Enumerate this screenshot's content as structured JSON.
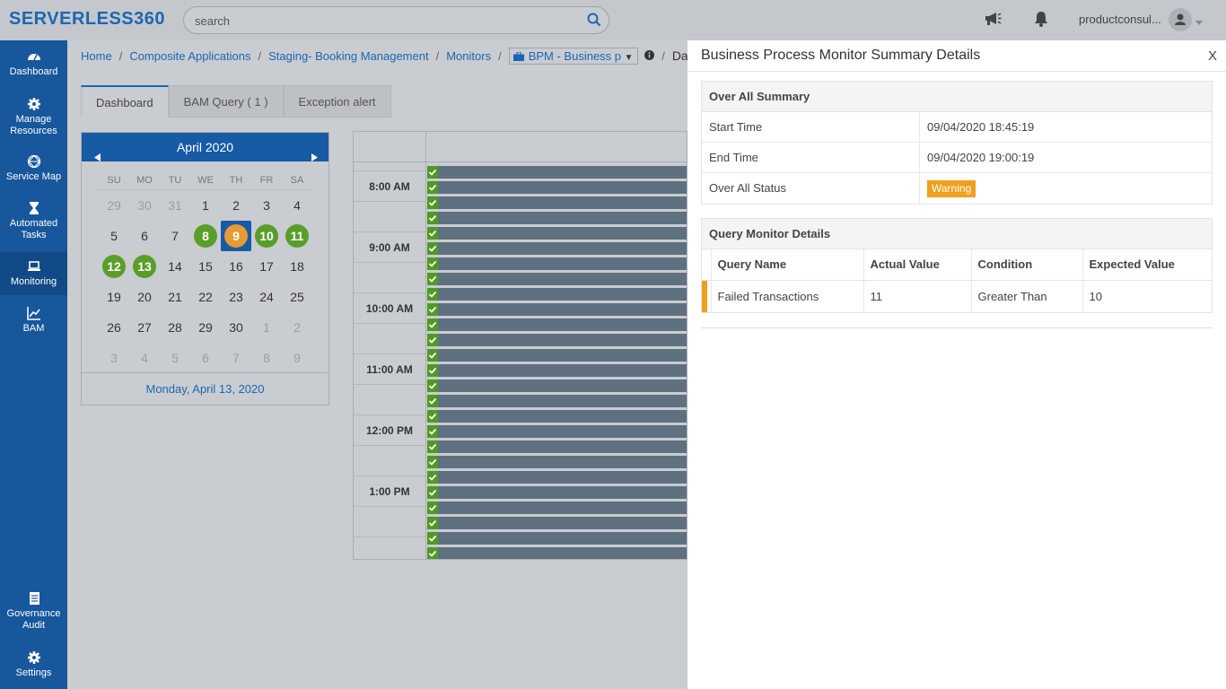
{
  "app": {
    "logo": "SERVERLESS",
    "logo_suffix": "360"
  },
  "search": {
    "placeholder": "search"
  },
  "header": {
    "user_name": "productconsul..."
  },
  "sidebar": {
    "items": [
      {
        "label": "Dashboard",
        "icon": "dashboard-icon"
      },
      {
        "label": "Manage Resources",
        "icon": "gear-icon"
      },
      {
        "label": "Service Map",
        "icon": "service-map-icon"
      },
      {
        "label": "Automated Tasks",
        "icon": "hourglass-icon"
      },
      {
        "label": "Monitoring",
        "icon": "laptop-icon",
        "active": true
      },
      {
        "label": "BAM",
        "icon": "chart-line-icon"
      },
      {
        "label": "Governance Audit",
        "icon": "document-icon"
      },
      {
        "label": "Settings",
        "icon": "gear-icon"
      }
    ]
  },
  "breadcrumb": {
    "home": "Home",
    "composite": "Composite Applications",
    "staging": "Staging- Booking Management",
    "monitors": "Monitors",
    "bpm": "BPM - Business p",
    "current": "Dash"
  },
  "tabs": [
    "Dashboard",
    "BAM Query ( 1 )",
    "Exception alert"
  ],
  "calendar": {
    "month_label": "April 2020",
    "dow": [
      "SU",
      "MO",
      "TU",
      "WE",
      "TH",
      "FR",
      "SA"
    ],
    "weeks": [
      [
        "29",
        "30",
        "31",
        "1",
        "2",
        "3",
        "4"
      ],
      [
        "5",
        "6",
        "7",
        "8",
        "9",
        "10",
        "11"
      ],
      [
        "12",
        "13",
        "14",
        "15",
        "16",
        "17",
        "18"
      ],
      [
        "19",
        "20",
        "21",
        "22",
        "23",
        "24",
        "25"
      ],
      [
        "26",
        "27",
        "28",
        "29",
        "30",
        "1",
        "2"
      ],
      [
        "3",
        "4",
        "5",
        "6",
        "7",
        "8",
        "9"
      ]
    ],
    "selected_date_label": "Monday, April 13, 2020"
  },
  "schedule": {
    "times": [
      "8:00 AM",
      "9:00 AM",
      "10:00 AM",
      "11:00 AM",
      "12:00 PM",
      "1:00 PM"
    ]
  },
  "panel": {
    "title": "Business Process Monitor Summary Details",
    "close_label": "X",
    "overall": {
      "heading": "Over All Summary",
      "start_label": "Start Time",
      "start_value": "09/04/2020 18:45:19",
      "end_label": "End Time",
      "end_value": "09/04/2020 19:00:19",
      "status_label": "Over All Status",
      "status_value": "Warning"
    },
    "query": {
      "heading": "Query Monitor Details",
      "columns": [
        "Query Name",
        "Actual Value",
        "Condition",
        "Expected Value"
      ],
      "rows": [
        [
          "Failed Transactions",
          "11",
          "Greater Than",
          "10"
        ]
      ]
    }
  },
  "colors": {
    "sidebar": "#17579c",
    "accent": "#1b67b3",
    "warning": "#f0a01e",
    "success": "#5a9e2a"
  }
}
